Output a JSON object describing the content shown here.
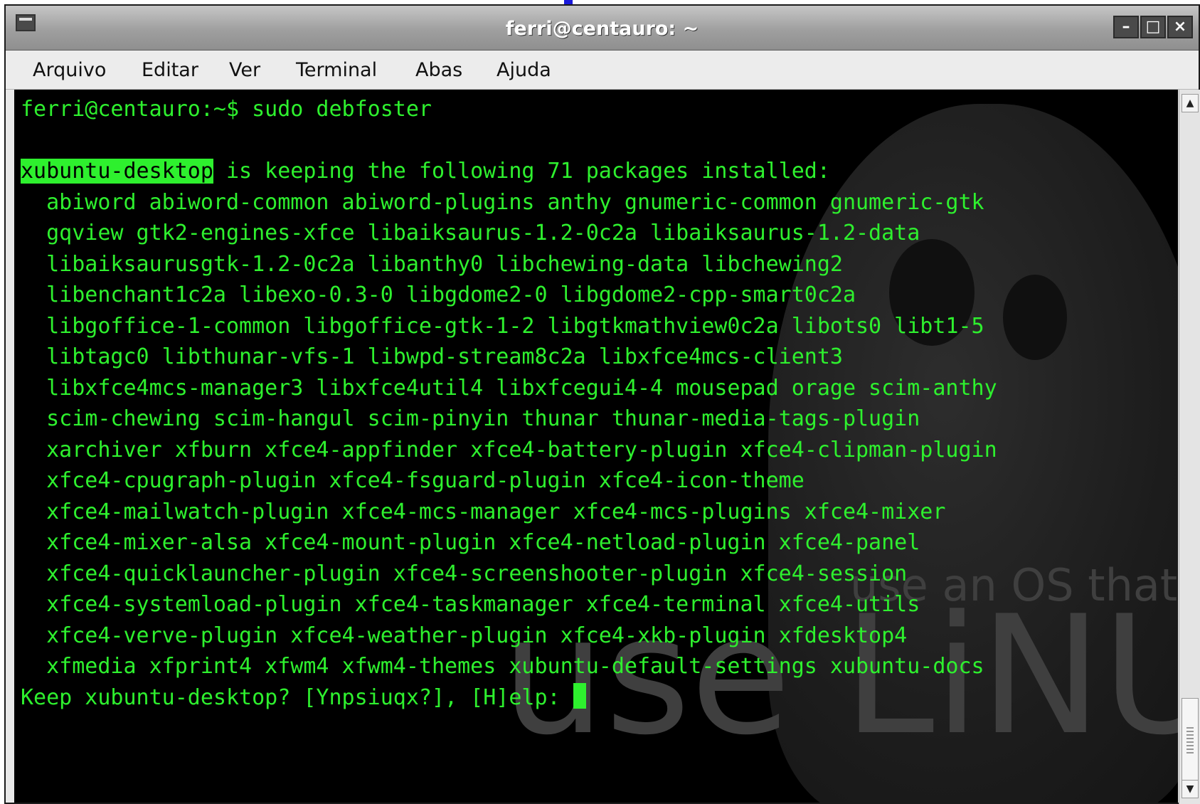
{
  "window": {
    "title": "ferri@centauro: ~",
    "controls": {
      "minimize": "–",
      "maximize": "□",
      "close": "×"
    }
  },
  "menubar": {
    "items": [
      "Arquivo",
      "Editar",
      "Ver",
      "Terminal",
      "Abas",
      "Ajuda"
    ]
  },
  "terminal": {
    "lines": [
      "ferri@centauro:~$ sudo debfoster",
      "",
      "xubuntu-desktop is keeping the following 71 packages installed:",
      "  abiword abiword-common abiword-plugins anthy gnumeric-common gnumeric-gtk",
      "  gqview gtk2-engines-xfce libaiksaurus-1.2-0c2a libaiksaurus-1.2-data",
      "  libaiksaurusgtk-1.2-0c2a libanthy0 libchewing-data libchewing2",
      "  libenchant1c2a libexo-0.3-0 libgdome2-0 libgdome2-cpp-smart0c2a",
      "  libgoffice-1-common libgoffice-gtk-1-2 libgtkmathview0c2a libots0 libt1-5",
      "  libtagc0 libthunar-vfs-1 libwpd-stream8c2a libxfce4mcs-client3",
      "  libxfce4mcs-manager3 libxfce4util4 libxfcegui4-4 mousepad orage scim-anthy",
      "  scim-chewing scim-hangul scim-pinyin thunar thunar-media-tags-plugin",
      "  xarchiver xfburn xfce4-appfinder xfce4-battery-plugin xfce4-clipman-plugin",
      "  xfce4-cpugraph-plugin xfce4-fsguard-plugin xfce4-icon-theme",
      "  xfce4-mailwatch-plugin xfce4-mcs-manager xfce4-mcs-plugins xfce4-mixer",
      "  xfce4-mixer-alsa xfce4-mount-plugin xfce4-netload-plugin xfce4-panel",
      "  xfce4-quicklauncher-plugin xfce4-screenshooter-plugin xfce4-session",
      "  xfce4-systemload-plugin xfce4-taskmanager xfce4-terminal xfce4-utils",
      "  xfce4-verve-plugin xfce4-weather-plugin xfce4-xkb-plugin xfdesktop4",
      "  xfmedia xfprint4 xfwm4 xfwm4-themes xubuntu-default-settings xubuntu-docs"
    ],
    "highlighted_package": "xubuntu-desktop",
    "prompt": "Keep xubuntu-desktop? [Ynpsiuqx?], [H]elp: ",
    "colors": {
      "foreground": "#2ef02e",
      "background": "#000000"
    }
  },
  "wallpaper": {
    "text_small": "use an OS that",
    "text_large": "use LiNU"
  },
  "scrollbar": {
    "up_arrow": "▲",
    "down_arrow": "▼"
  }
}
